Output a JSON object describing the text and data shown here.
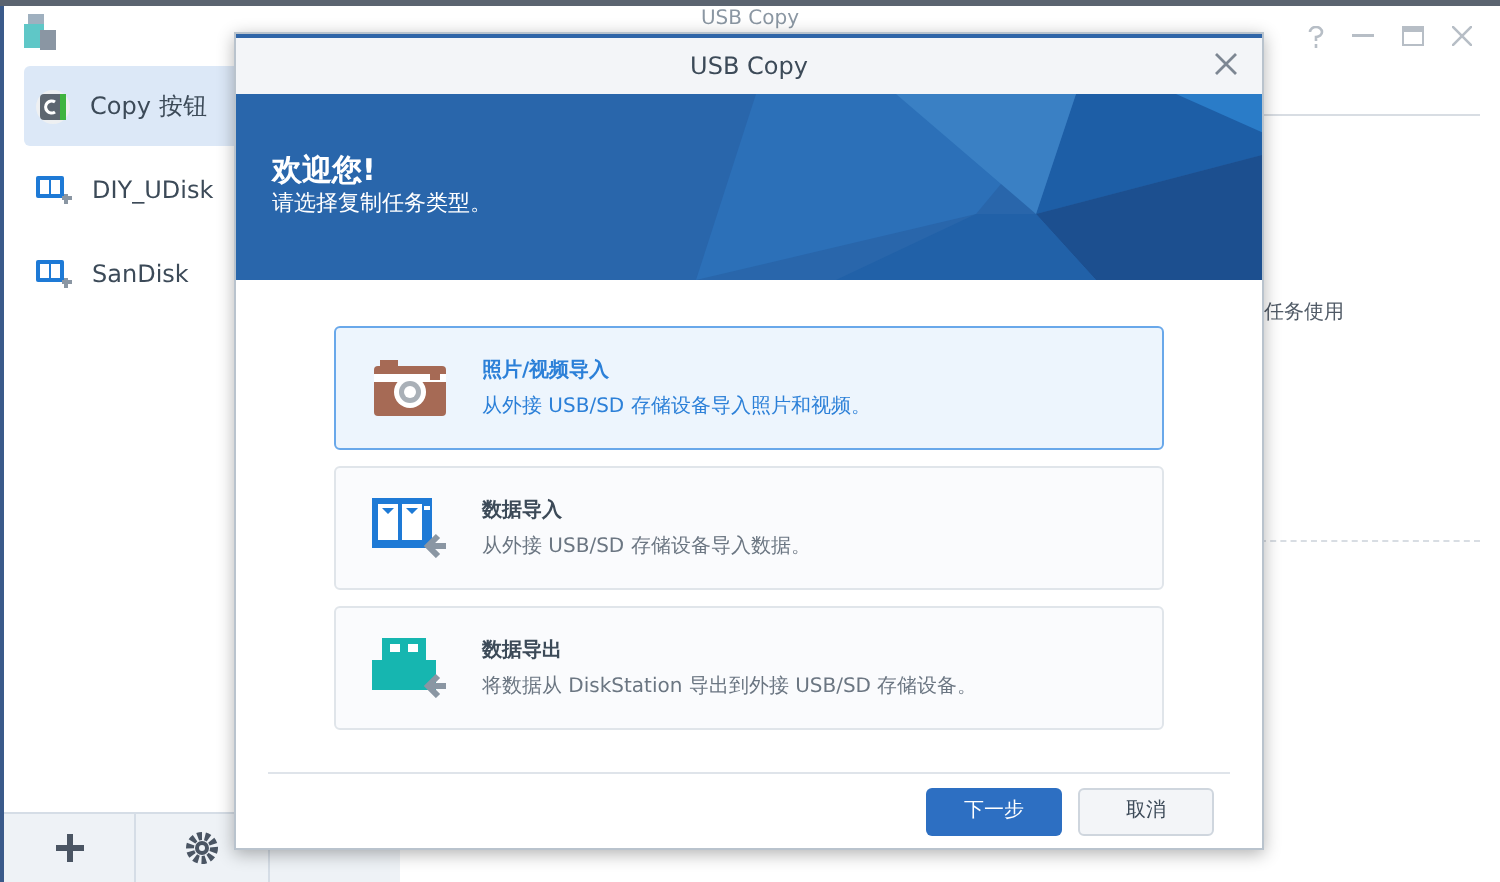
{
  "window": {
    "title": "USB Copy"
  },
  "sidebar": {
    "items": [
      {
        "label": "Copy 按钮",
        "kind": "copy",
        "selected": true
      },
      {
        "label": "DIY_UDisk",
        "kind": "usb",
        "selected": false
      },
      {
        "label": "SanDisk",
        "kind": "usb",
        "selected": false
      }
    ]
  },
  "background_text": "任务使用",
  "dialog": {
    "title": "USB Copy",
    "banner_title": "欢迎您!",
    "banner_subtitle": "请选择复制任务类型。",
    "options": [
      {
        "kind": "camera",
        "title": "照片/视频导入",
        "description": "从外接 USB/SD 存储设备导入照片和视频。",
        "selected": true
      },
      {
        "kind": "import",
        "title": "数据导入",
        "description": "从外接 USB/SD 存储设备导入数据。",
        "selected": false
      },
      {
        "kind": "export",
        "title": "数据导出",
        "description": "将数据从 DiskStation 导出到外接 USB/SD 存储设备。",
        "selected": false
      }
    ],
    "buttons": [
      {
        "label": "下一步",
        "kind": "primary"
      },
      {
        "label": "取消",
        "kind": "secondary"
      }
    ]
  }
}
